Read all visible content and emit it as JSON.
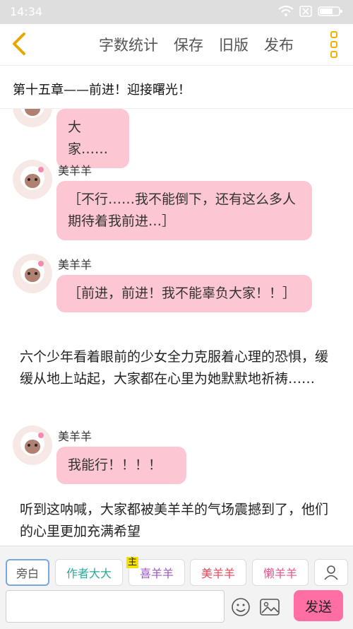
{
  "status_bar": {
    "time": "14:34"
  },
  "header": {
    "menu": [
      {
        "label": "字数统计"
      },
      {
        "label": "保存"
      },
      {
        "label": "旧版"
      },
      {
        "label": "发布"
      }
    ],
    "accent_color": "#f0b400"
  },
  "chapter": {
    "title": "第十五章——前进！迎接曙光！"
  },
  "messages": [
    {
      "type": "bubble",
      "name": "",
      "text": "大家……"
    },
    {
      "type": "bubble",
      "name": "美羊羊",
      "text": "［不行……我不能倒下，还有这么多人期待着我前进…］"
    },
    {
      "type": "bubble",
      "name": "美羊羊",
      "text": "［前进，前进！我不能辜负大家！！］"
    },
    {
      "type": "narration",
      "text": "六个少年看着眼前的少女全力克服着心理的恐惧，缓缓从地上站起，大家都在心里为她默默地祈祷……"
    },
    {
      "type": "bubble",
      "name": "美羊羊",
      "text": "我能行！！！！"
    },
    {
      "type": "narration",
      "text": "听到这呐喊，大家都被美羊羊的气场震撼到了，他们的心里更加充满希望"
    }
  ],
  "roles": [
    {
      "label": "旁白",
      "color": "#555555"
    },
    {
      "label": "作者大大",
      "color": "#2ba79b"
    },
    {
      "label": "喜羊羊",
      "color": "#9b59c4",
      "badge": "主"
    },
    {
      "label": "美羊羊",
      "color": "#e8455a"
    },
    {
      "label": "懒羊羊",
      "color": "#e0558a"
    }
  ],
  "composer": {
    "send_label": "发送",
    "send_color": "#ff6fa3"
  },
  "bubble_color": "#fcc7d3"
}
